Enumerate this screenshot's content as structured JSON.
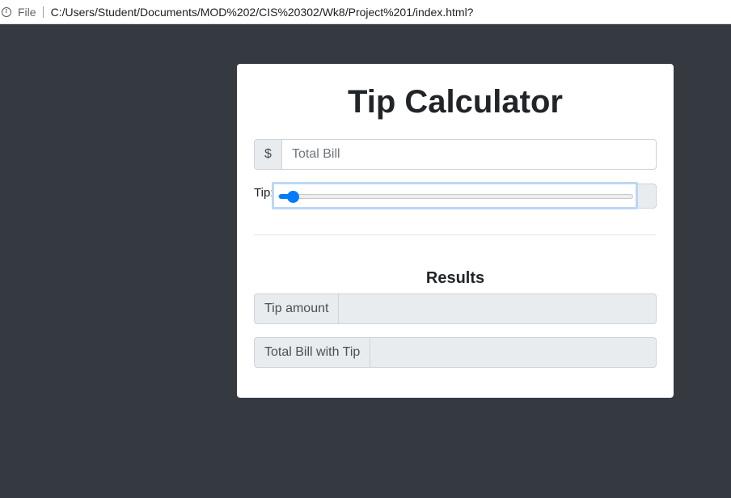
{
  "browser": {
    "scheme": "File",
    "url": "C:/Users/Student/Documents/MOD%202/CIS%20302/Wk8/Project%201/index.html?"
  },
  "calculator": {
    "title": "Tip Calculator",
    "bill": {
      "prefix": "$",
      "placeholder": "Total Bill",
      "value": ""
    },
    "tip": {
      "label": "Tip:",
      "slider_value_fraction": 0.04
    },
    "results": {
      "heading": "Results",
      "tip_amount_label": "Tip amount",
      "tip_amount_value": "",
      "total_label": "Total Bill with Tip",
      "total_value": ""
    }
  },
  "colors": {
    "page_background": "#343a40",
    "accent": "#007bff",
    "addon_background": "#e9ecef"
  }
}
